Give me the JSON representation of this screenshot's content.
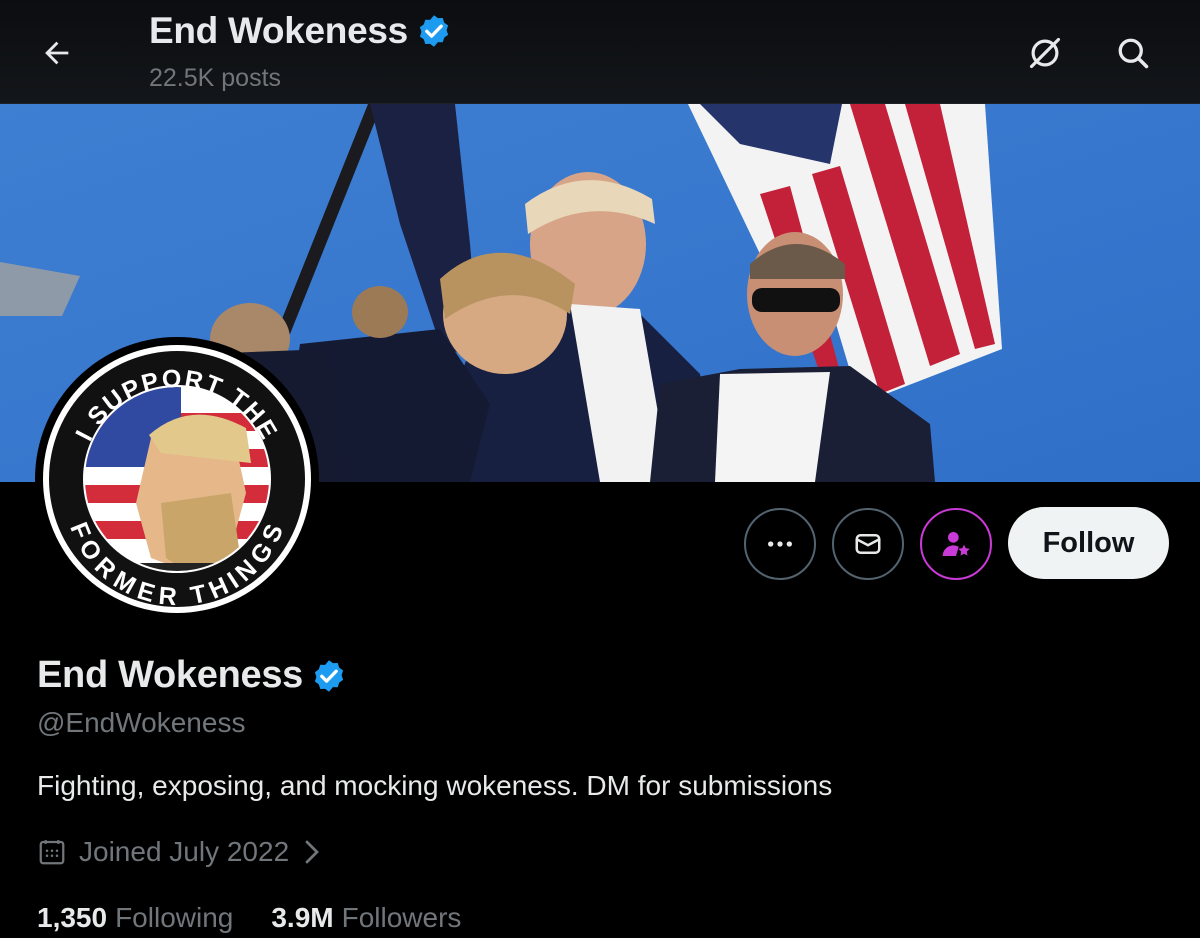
{
  "header": {
    "name": "End Wokeness",
    "posts": "22.5K posts"
  },
  "avatar": {
    "ring_text_top": "I SUPPORT THE",
    "ring_text_bottom": "FORMER THINGS"
  },
  "actions": {
    "follow_label": "Follow"
  },
  "profile": {
    "name": "End Wokeness",
    "handle": "@EndWokeness",
    "bio": "Fighting, exposing, and mocking wokeness. DM for submissions",
    "joined": "Joined July 2022",
    "following_count": "1,350",
    "following_label": "Following",
    "followers_count": "3.9M",
    "followers_label": "Followers"
  },
  "icons": [
    "back-arrow-icon",
    "grok-icon",
    "search-icon",
    "verified-badge-icon",
    "more-icon",
    "message-icon",
    "subscribe-icon",
    "calendar-icon",
    "chevron-right-icon"
  ],
  "colors": {
    "background": "#000000",
    "text_primary": "#e7e9ea",
    "text_secondary": "#71767b",
    "verified_blue": "#1d9bf0",
    "subscribe_purple": "#c93ad7",
    "follow_bg": "#eff3f4",
    "banner_sky": "#3f7fd2"
  }
}
